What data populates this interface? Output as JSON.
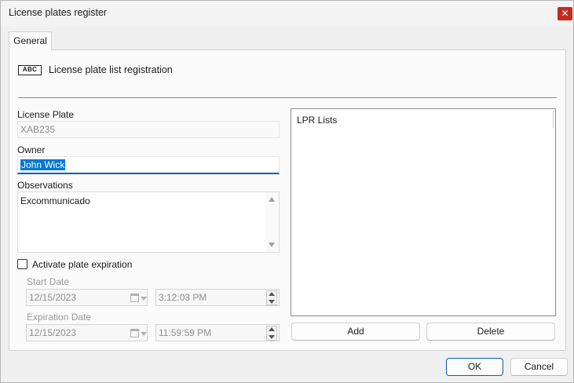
{
  "window": {
    "title": "License plates register",
    "close_glyph": "✕"
  },
  "tabs": [
    {
      "label": "General"
    }
  ],
  "header": {
    "icon_text": "ABC",
    "label": "License plate list registration"
  },
  "form": {
    "license_plate": {
      "label": "License Plate",
      "value": "XAB235"
    },
    "owner": {
      "label": "Owner",
      "value": "John Wick"
    },
    "observations": {
      "label": "Observations",
      "value": "Excommunicado"
    },
    "expiration_toggle": {
      "label": "Activate plate expiration",
      "checked": false
    },
    "start": {
      "label": "Start Date",
      "date": "12/15/2023",
      "time": "3:12:03 PM"
    },
    "expiration": {
      "label": "Expiration Date",
      "date": "12/15/2023",
      "time": "11:59:59 PM"
    }
  },
  "lpr_lists": {
    "header": "LPR Lists",
    "items": []
  },
  "buttons": {
    "add": "Add",
    "delete": "Delete",
    "ok": "OK",
    "cancel": "Cancel"
  },
  "colors": {
    "accent": "#005fb8",
    "close": "#c42b1c",
    "selection": "#0078d7"
  },
  "icons": {
    "close": "close-icon",
    "license_plate": "license-plate-icon",
    "calendar": "calendar-icon"
  }
}
